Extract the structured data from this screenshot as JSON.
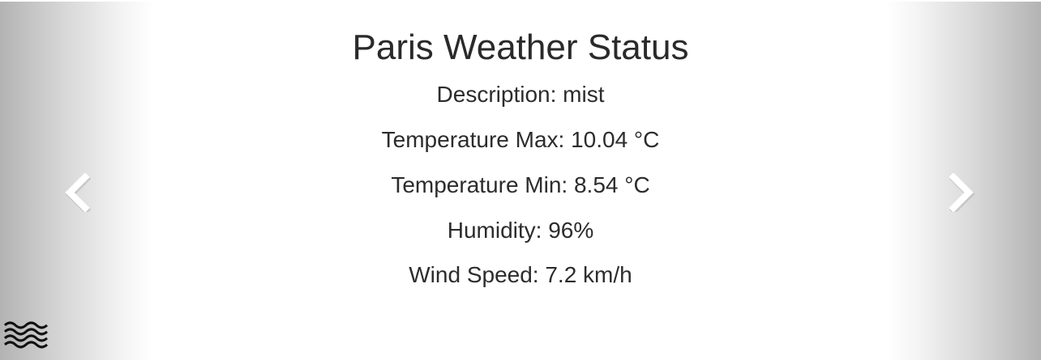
{
  "slide": {
    "title": "Paris Weather Status",
    "description": "Description: mist",
    "temp_max": "Temperature Max: 10.04 °C",
    "temp_min": "Temperature Min: 8.54 °C",
    "humidity": "Humidity: 96%",
    "wind_speed": "Wind Speed: 7.2 km/h"
  },
  "controls": {
    "prev_icon": "chevron-left-icon",
    "next_icon": "chevron-right-icon"
  },
  "weather_icon": "mist-icon",
  "colors": {
    "text": "#2b2b2b",
    "edge_fade": "#b3b3b3",
    "chevron": "#ffffff"
  }
}
